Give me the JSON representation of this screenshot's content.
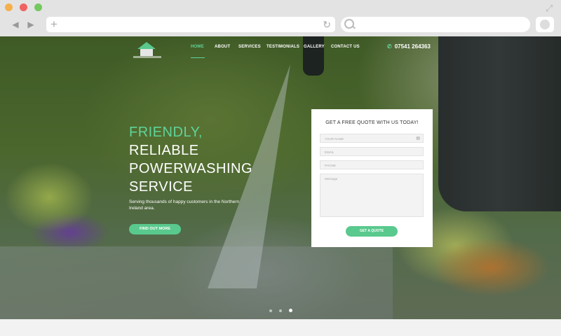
{
  "browser": {
    "controls": {
      "close_color": "#f6b04b",
      "min_color": "#f26161",
      "max_color": "#73c95d"
    },
    "url_bar": {
      "value": "",
      "placeholder": ""
    },
    "search_bar": {
      "value": "",
      "placeholder": ""
    }
  },
  "site": {
    "nav": {
      "items": [
        {
          "label": "HOME",
          "active": true
        },
        {
          "label": "ABOUT"
        },
        {
          "label": "SERVICES"
        },
        {
          "label": "TESTIMONIALS"
        },
        {
          "label": "GALLERY"
        },
        {
          "label": "CONTACT US"
        }
      ],
      "phone": "07541 264363"
    },
    "hero": {
      "headline_line1": "FRIENDLY,",
      "headline_line2": "RELIABLE",
      "headline_line3": "POWERWASHING",
      "headline_line4": "SERVICE",
      "subcopy": "Serving thousands of happy customers in the Northern Ireland area.",
      "cta_label": "FIND OUT MORE",
      "slider_dots": 3,
      "active_slide": 3
    },
    "quote_form": {
      "title": "GET A FREE QUOTE WITH US TODAY!",
      "fields": {
        "name_placeholder": "YOUR NAME",
        "email_placeholder": "EMAIL",
        "phone_placeholder": "PHONE",
        "message_placeholder": "Message"
      },
      "submit_label": "GET A QUOTE"
    },
    "accent_color": "#5fd39a"
  }
}
